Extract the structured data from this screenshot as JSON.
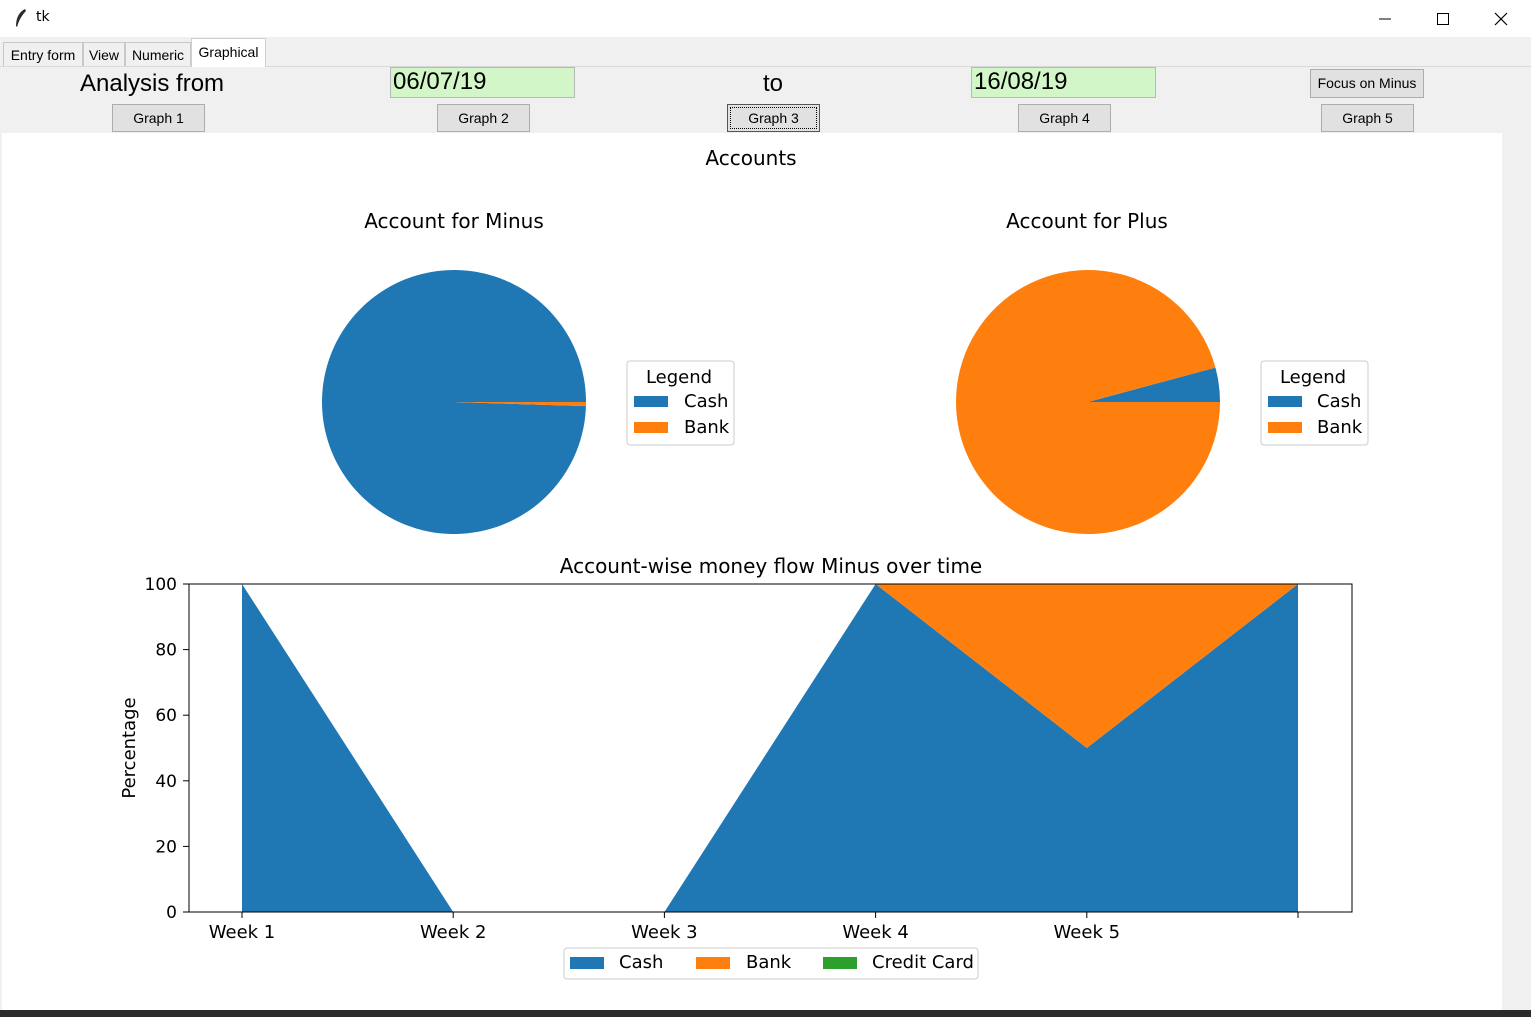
{
  "window": {
    "title": "tk"
  },
  "tabs": [
    {
      "label": "Entry form",
      "active": false
    },
    {
      "label": "View",
      "active": false
    },
    {
      "label": "Numeric",
      "active": false
    },
    {
      "label": "Graphical",
      "active": true
    }
  ],
  "controls": {
    "analysis_label": "Analysis from",
    "from_date": "06/07/19",
    "to_label": "to",
    "to_date": "16/08/19",
    "focus_button": "Focus on Minus",
    "graph_buttons": [
      "Graph 1",
      "Graph 2",
      "Graph 3",
      "Graph 4",
      "Graph 5"
    ],
    "focused_graph": 3
  },
  "colors": {
    "cash": "#1f77b4",
    "bank": "#ff7f0e",
    "credit_card": "#2ca02c",
    "date_bg": "#d3f6c8"
  },
  "figure": {
    "suptitle": "Accounts"
  },
  "chart_data": [
    {
      "type": "pie",
      "title": "Account for Minus",
      "labels": [
        "Cash",
        "Bank"
      ],
      "values": [
        99.5,
        0.5
      ],
      "legend_title": "Legend",
      "legend_position": "right"
    },
    {
      "type": "pie",
      "title": "Account for Plus",
      "labels": [
        "Cash",
        "Bank"
      ],
      "values": [
        4.2,
        95.8
      ],
      "legend_title": "Legend",
      "legend_position": "right"
    },
    {
      "type": "area",
      "title": "Account-wise money flow Minus over time",
      "ylabel": "Percentage",
      "xlabel": "",
      "categories": [
        "Week 1",
        "Week 2",
        "Week 3",
        "Week 4",
        "Week 5",
        ""
      ],
      "yticks": [
        0,
        20,
        40,
        60,
        80,
        100
      ],
      "ylim": [
        0,
        100
      ],
      "stacked": true,
      "series": [
        {
          "name": "Cash",
          "values": [
            100,
            0,
            0,
            100,
            50,
            100
          ]
        },
        {
          "name": "Bank",
          "values": [
            0,
            0,
            0,
            0,
            50,
            0
          ]
        },
        {
          "name": "Credit Card",
          "values": [
            0,
            0,
            0,
            0,
            0,
            0
          ]
        }
      ],
      "legend_position": "bottom"
    }
  ]
}
